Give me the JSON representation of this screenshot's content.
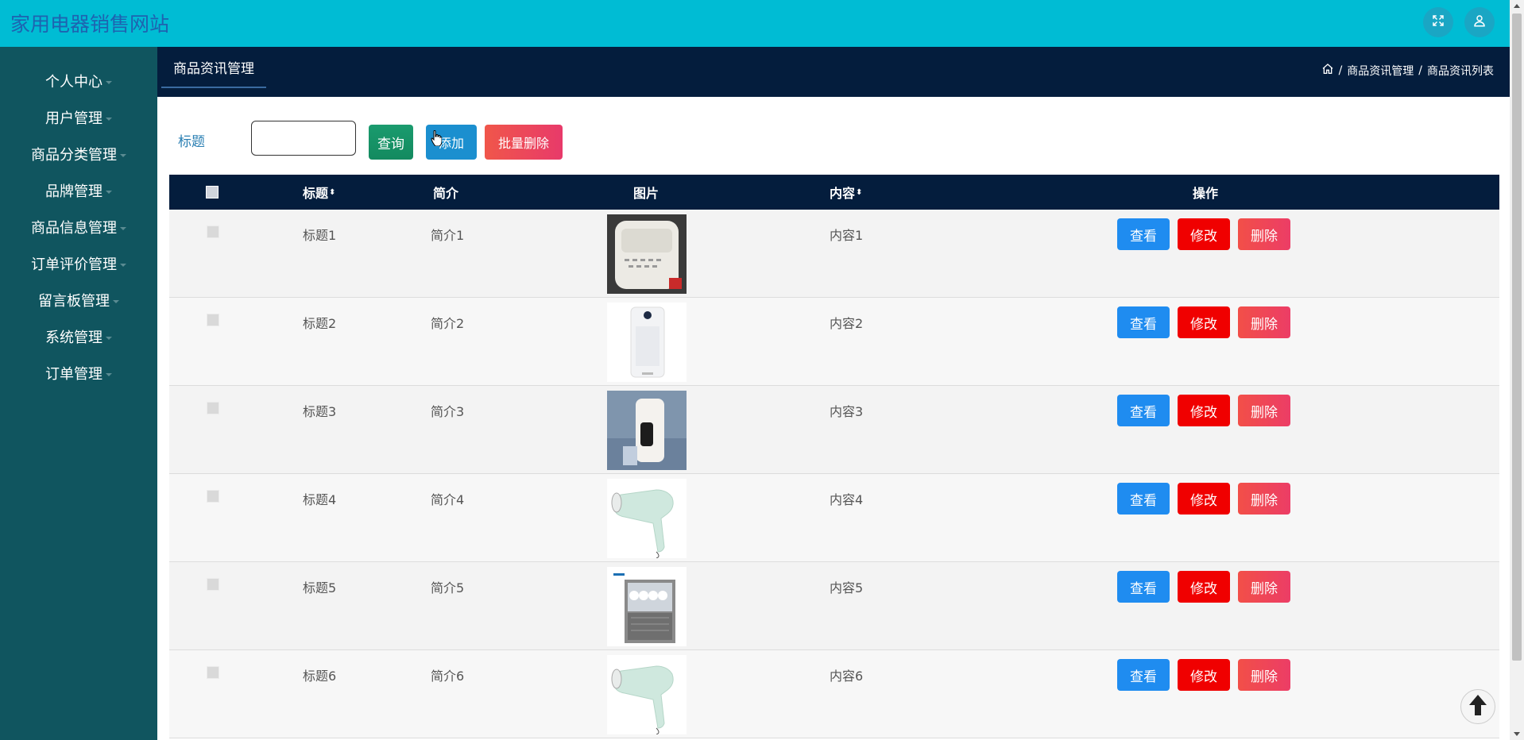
{
  "site": {
    "title": "家用电器销售网站"
  },
  "topbar": {
    "icons": [
      "fullscreen-icon",
      "user-icon"
    ]
  },
  "sidebar": {
    "items": [
      {
        "label": "个人中心"
      },
      {
        "label": "用户管理"
      },
      {
        "label": "商品分类管理"
      },
      {
        "label": "品牌管理"
      },
      {
        "label": "商品信息管理"
      },
      {
        "label": "订单评价管理"
      },
      {
        "label": "留言板管理"
      },
      {
        "label": "系统管理"
      },
      {
        "label": "订单管理"
      }
    ]
  },
  "header": {
    "tab": "商品资讯管理",
    "breadcrumb": {
      "sep1": "/",
      "level1": "商品资讯管理",
      "sep2": "/",
      "level2": "商品资讯列表"
    }
  },
  "search": {
    "label": "标题",
    "value": "",
    "query_label": "查询",
    "add_label": "添加",
    "batch_delete_label": "批量删除"
  },
  "table": {
    "columns": {
      "title": "标题",
      "intro": "简介",
      "image": "图片",
      "content": "内容",
      "actions": "操作"
    },
    "sort_glyph": "⬍",
    "actions": {
      "view": "查看",
      "edit": "修改",
      "delete": "删除"
    },
    "rows": [
      {
        "title": "标题1",
        "intro": "简介1",
        "content": "内容1",
        "image": "rice-cooker"
      },
      {
        "title": "标题2",
        "intro": "简介2",
        "content": "内容2",
        "image": "air-purifier"
      },
      {
        "title": "标题3",
        "intro": "简介3",
        "content": "内容3",
        "image": "water-dispenser"
      },
      {
        "title": "标题4",
        "intro": "简介4",
        "content": "内容4",
        "image": "hair-dryer"
      },
      {
        "title": "标题5",
        "intro": "简介5",
        "content": "内容5",
        "image": "dishwasher"
      },
      {
        "title": "标题6",
        "intro": "简介6",
        "content": "内容6",
        "image": "hair-dryer"
      }
    ]
  },
  "colors": {
    "topbar": "#00bcd4",
    "sidebar": "#10555f",
    "header": "#041d3d",
    "view": "#1f8cf0",
    "edit": "#f00000",
    "delete": "#ec3d66"
  }
}
